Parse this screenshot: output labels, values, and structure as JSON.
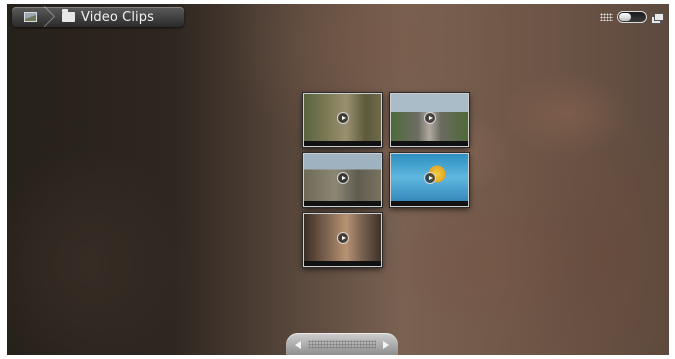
{
  "breadcrumb": {
    "home_icon": "gallery-icon",
    "folder_icon": "folder-icon",
    "current_label": "Video Clips"
  },
  "view_toggle": {
    "left_icon": "grid-icon",
    "right_icon": "slideshow-icon",
    "state": "grid"
  },
  "grid": {
    "items": [
      {
        "type": "video",
        "icon": "play-icon"
      },
      {
        "type": "video",
        "icon": "play-icon"
      },
      {
        "type": "video",
        "icon": "play-icon"
      },
      {
        "type": "video",
        "icon": "play-icon"
      },
      {
        "type": "video",
        "icon": "play-icon"
      }
    ]
  },
  "scroller": {
    "left_icon": "chevron-left-icon",
    "right_icon": "chevron-right-icon"
  }
}
